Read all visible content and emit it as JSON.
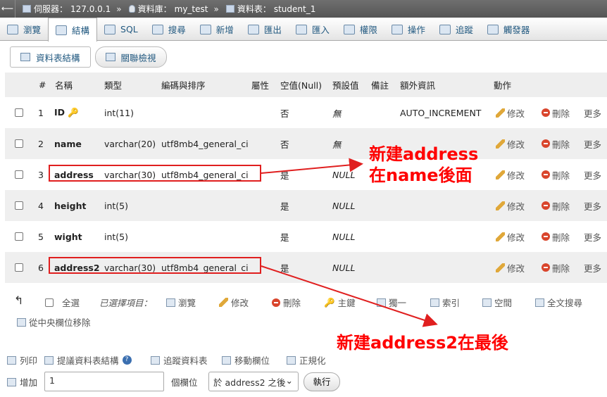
{
  "breadcrumb": {
    "back": "⟵",
    "server_label": "伺服器：",
    "server": "127.0.0.1",
    "db_label": "資料庫：",
    "db": "my_test",
    "table_label": "資料表：",
    "table": "student_1",
    "sep": "»"
  },
  "tabs": [
    "瀏覽",
    "結構",
    "SQL",
    "搜尋",
    "新增",
    "匯出",
    "匯入",
    "權限",
    "操作",
    "追蹤",
    "觸發器"
  ],
  "subtabs": [
    "資料表結構",
    "關聯檢視"
  ],
  "headers": {
    "num": "#",
    "name": "名稱",
    "type": "類型",
    "collation": "編碼與排序",
    "attr": "屬性",
    "null": "空值(Null)",
    "default": "預設值",
    "comment": "備註",
    "extra": "額外資訊",
    "action": "動作"
  },
  "rows": [
    {
      "n": "1",
      "name": "ID",
      "type": "int(11)",
      "collation": "",
      "null": "否",
      "default": "無",
      "extra": "AUTO_INCREMENT"
    },
    {
      "n": "2",
      "name": "name",
      "type": "varchar(20)",
      "collation": "utf8mb4_general_ci",
      "null": "否",
      "default": "無",
      "extra": ""
    },
    {
      "n": "3",
      "name": "address",
      "type": "varchar(30)",
      "collation": "utf8mb4_general_ci",
      "null": "是",
      "default": "NULL",
      "extra": ""
    },
    {
      "n": "4",
      "name": "height",
      "type": "int(5)",
      "collation": "",
      "null": "是",
      "default": "NULL",
      "extra": ""
    },
    {
      "n": "5",
      "name": "wight",
      "type": "int(5)",
      "collation": "",
      "null": "是",
      "default": "NULL",
      "extra": ""
    },
    {
      "n": "6",
      "name": "address2",
      "type": "varchar(30)",
      "collation": "utf8mb4_general_ci",
      "null": "是",
      "default": "NULL",
      "extra": ""
    }
  ],
  "row_actions": {
    "edit": "修改",
    "delete": "刪除",
    "more": "更多"
  },
  "bulk": {
    "select_all": "全選",
    "selected": "已選擇項目：",
    "browse": "瀏覽",
    "edit": "修改",
    "delete": "刪除",
    "primary": "主鍵",
    "unique": "獨一",
    "index": "索引",
    "spatial": "空間",
    "fulltext": "全文搜尋",
    "remove_central": "從中央欄位移除"
  },
  "tools": {
    "print": "列印",
    "propose": "提議資料表結構",
    "track": "追蹤資料表",
    "move": "移動欄位",
    "normalize": "正規化"
  },
  "add": {
    "label": "增加",
    "count": "1",
    "columns_label": "個欄位",
    "position": "於 address2 之後",
    "execute": "執行"
  },
  "annotations": {
    "note1_line1": "新建address",
    "note1_line2": "在name後面",
    "note2": "新建address2在最後"
  },
  "colors": {
    "annotation": "#ff0000",
    "link": "#235a81"
  }
}
